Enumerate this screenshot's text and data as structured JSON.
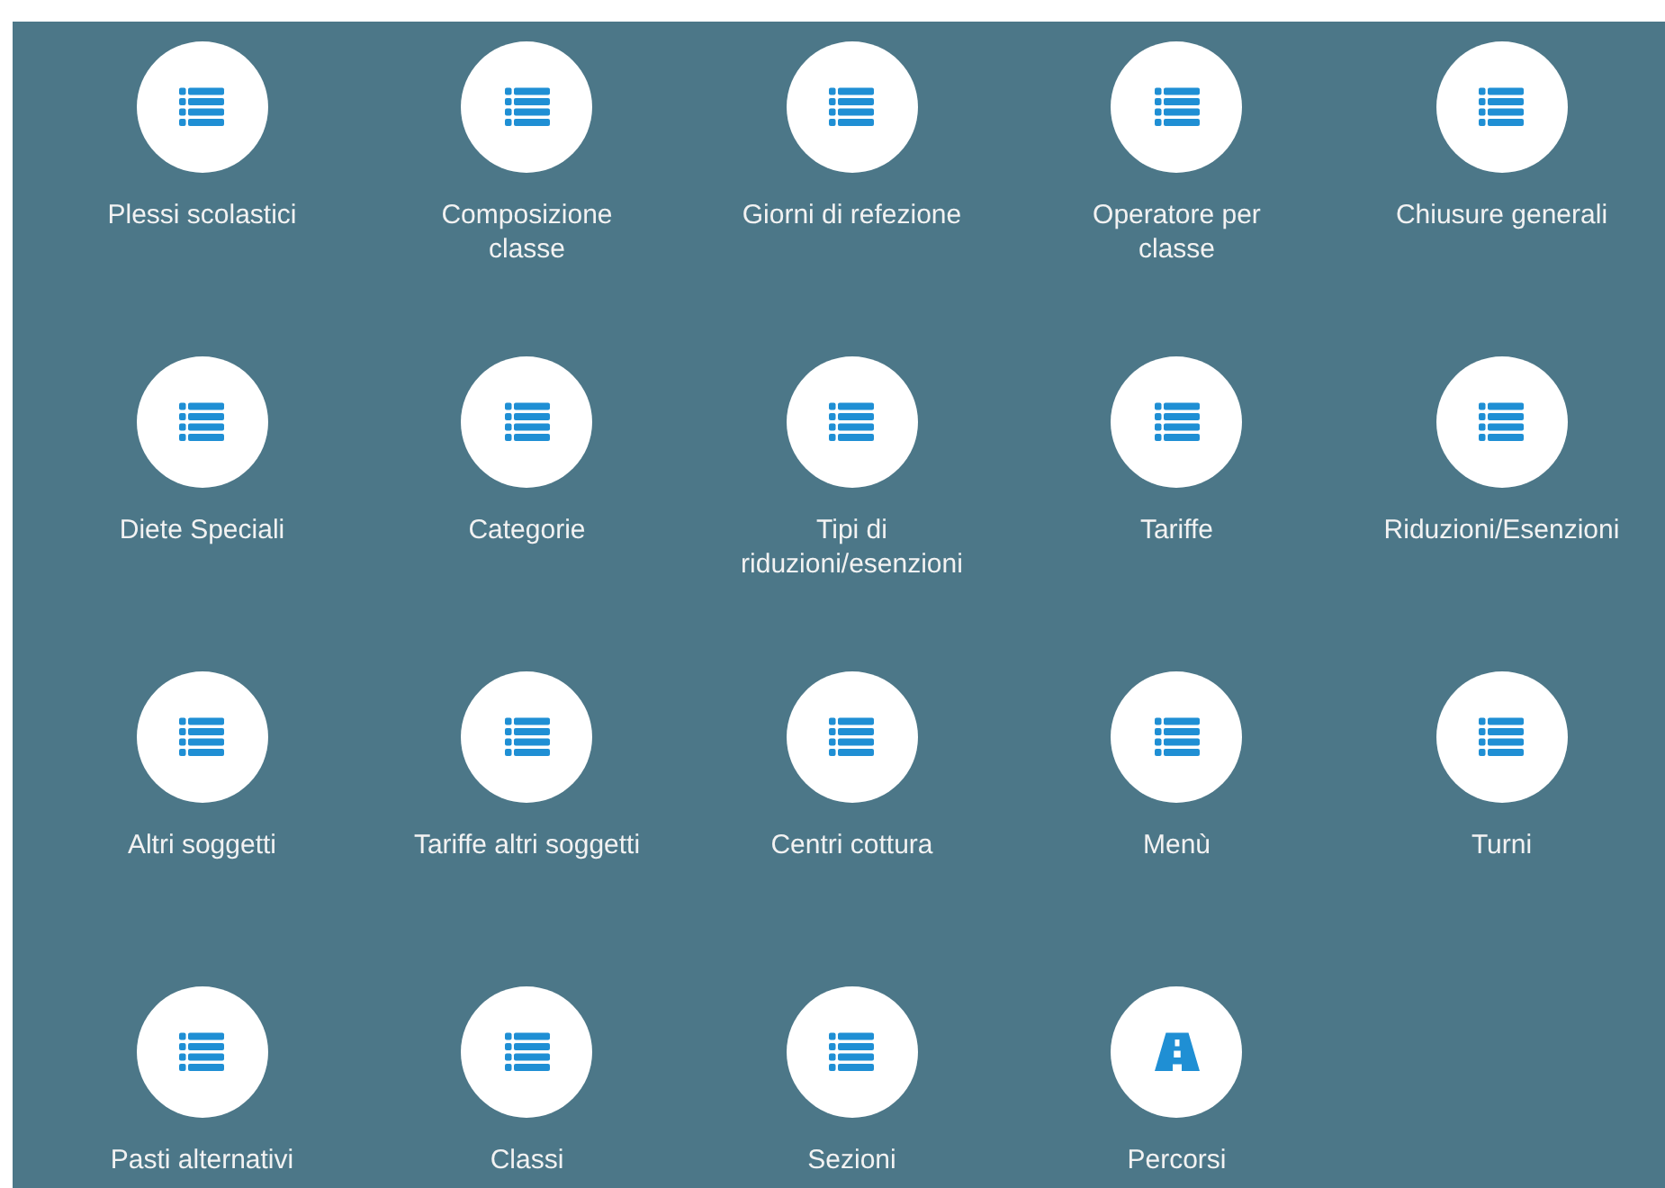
{
  "tiles": [
    {
      "label": "Plessi scolastici",
      "kind": "list"
    },
    {
      "label": "Composizione classe",
      "kind": "list"
    },
    {
      "label": "Giorni di refezione",
      "kind": "list"
    },
    {
      "label": "Operatore per classe",
      "kind": "list"
    },
    {
      "label": "Chiusure generali",
      "kind": "list"
    },
    {
      "label": "Diete Speciali",
      "kind": "list"
    },
    {
      "label": "Categorie",
      "kind": "list"
    },
    {
      "label": "Tipi di riduzioni/esenzioni",
      "kind": "list"
    },
    {
      "label": "Tariffe",
      "kind": "list"
    },
    {
      "label": "Riduzioni/Esenzioni",
      "kind": "list"
    },
    {
      "label": "Altri soggetti",
      "kind": "list"
    },
    {
      "label": "Tariffe altri soggetti",
      "kind": "list"
    },
    {
      "label": "Centri cottura",
      "kind": "list"
    },
    {
      "label": "Menù",
      "kind": "list"
    },
    {
      "label": "Turni",
      "kind": "list"
    },
    {
      "label": "Pasti alternativi",
      "kind": "list"
    },
    {
      "label": "Classi",
      "kind": "list"
    },
    {
      "label": "Sezioni",
      "kind": "list"
    },
    {
      "label": "Percorsi",
      "kind": "road"
    }
  ]
}
